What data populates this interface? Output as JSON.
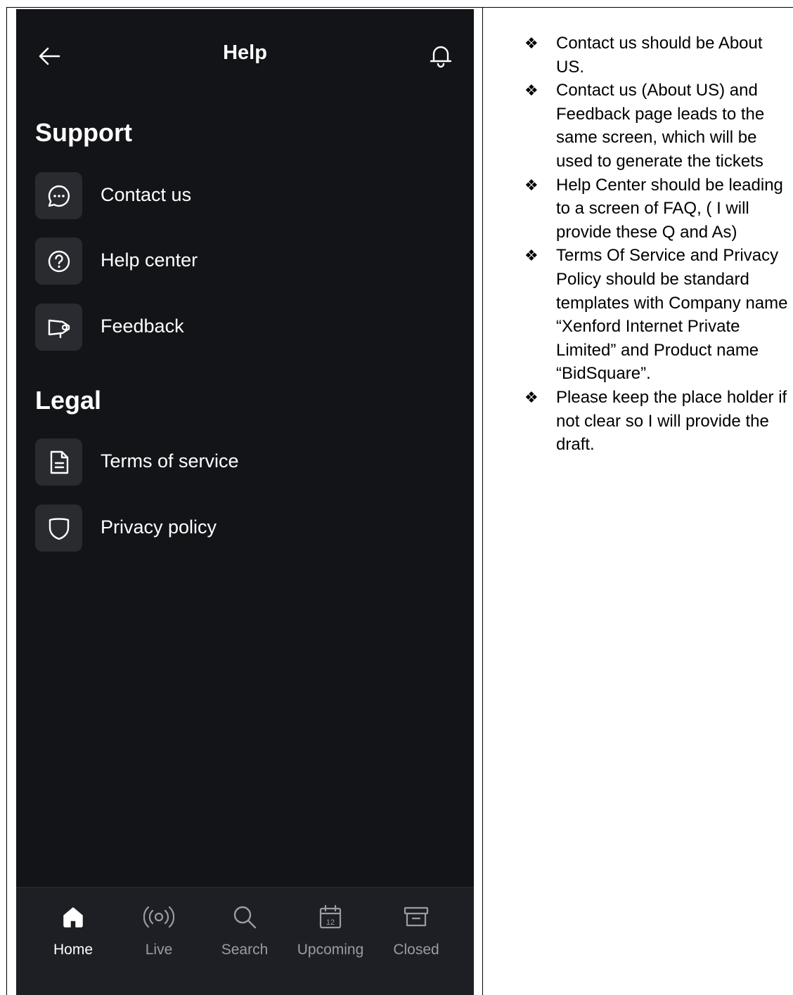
{
  "header": {
    "title": "Help"
  },
  "sections": [
    {
      "title": "Support",
      "items": [
        {
          "label": "Contact us",
          "icon": "chat-bubble-icon"
        },
        {
          "label": "Help center",
          "icon": "question-circle-icon"
        },
        {
          "label": "Feedback",
          "icon": "megaphone-icon"
        }
      ]
    },
    {
      "title": "Legal",
      "items": [
        {
          "label": "Terms of service",
          "icon": "document-icon"
        },
        {
          "label": "Privacy policy",
          "icon": "shield-icon"
        }
      ]
    }
  ],
  "nav": [
    {
      "label": "Home",
      "icon": "home-icon",
      "active": true
    },
    {
      "label": "Live",
      "icon": "broadcast-icon",
      "active": false
    },
    {
      "label": "Search",
      "icon": "search-icon",
      "active": false
    },
    {
      "label": "Upcoming",
      "icon": "calendar-icon",
      "active": false,
      "badge": "12"
    },
    {
      "label": "Closed",
      "icon": "archive-icon",
      "active": false
    }
  ],
  "notes": {
    "bullet": "❖",
    "items": [
      "Contact us should be About US.",
      "Contact us (About US) and Feedback page leads to the same screen, which will be used to generate the tickets",
      "Help Center should be leading to a screen of FAQ, ( I will provide these Q and As)",
      "Terms Of Service and Privacy Policy should be standard templates with Company name “Xenford Internet Private Limited” and Product name “BidSquare”.",
      "Please keep the place holder if not clear so I will provide the draft."
    ]
  },
  "colors": {
    "background": "#131418",
    "tile": "#2a2b30",
    "navbar": "#1e1f24",
    "active": "#ffffff",
    "inactive": "#9b9ca2"
  }
}
